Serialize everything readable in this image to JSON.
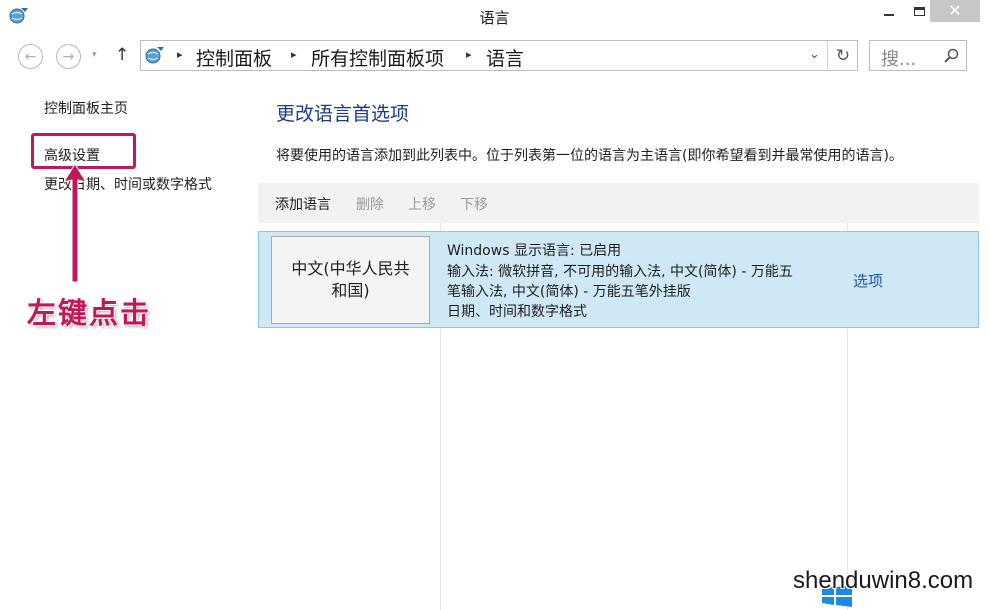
{
  "window": {
    "title": "语言",
    "close_glyph": "✕"
  },
  "address_bar": {
    "breadcrumbs": [
      "控制面板",
      "所有控制面板项",
      "语言"
    ],
    "separator": "▸",
    "search_placeholder": "搜..."
  },
  "nav": {
    "back_glyph": "←",
    "forward_glyph": "→",
    "dropdown_glyph": "▾",
    "up_glyph": "↑",
    "refresh_glyph": "↻",
    "addr_dropdown_glyph": "⌄"
  },
  "sidebar": {
    "items": [
      {
        "label": "控制面板主页"
      },
      {
        "label": "高级设置"
      },
      {
        "label": "更改日期、时间或数字格式"
      }
    ]
  },
  "annotation": {
    "text": "左键点击",
    "color": "#c2185b"
  },
  "main": {
    "title": "更改语言首选项",
    "description": "将要使用的语言添加到此列表中。位于列表第一位的语言为主语言(即你希望看到并最常使用的语言)。",
    "toolbar": {
      "add": "添加语言",
      "delete": "删除",
      "move_up": "上移",
      "move_down": "下移"
    },
    "languages": [
      {
        "name": "中文(中华人民共和国)",
        "details": [
          "Windows 显示语言: 已启用",
          "输入法: 微软拼音, 不可用的输入法, 中文(简体) - 万能五",
          "笔输入法, 中文(简体) - 万能五笔外挂版",
          "日期、时间和数字格式"
        ],
        "options_label": "选项"
      }
    ]
  },
  "watermark": {
    "text": "shenduwin8.com"
  },
  "colors": {
    "accent_title": "#1e3a8a",
    "selected_row": "#cfe8f6",
    "link": "#1e5aa8"
  },
  "icons": [
    "control-panel-icon",
    "back-arrow-icon",
    "forward-arrow-icon",
    "up-arrow-icon",
    "refresh-icon",
    "search-icon",
    "minimize-icon",
    "maximize-icon",
    "close-icon"
  ]
}
